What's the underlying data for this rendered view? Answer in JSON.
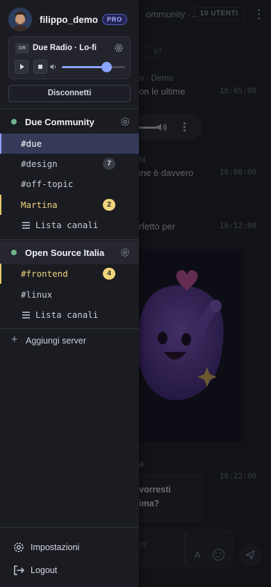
{
  "chat": {
    "title": "ommunity ·…",
    "users_badge": "10 UTENTI",
    "day_label": "ET",
    "messages": [
      {
        "author": "o · Demo",
        "text": "on le ultime",
        "time": "16:05:00"
      },
      {
        "author": "hi",
        "text": "ine è davvero",
        "time": "16:08:00"
      },
      {
        "author": "",
        "text": "rfetto per",
        "time": "16:12:00"
      },
      {
        "author": "a",
        "text": "",
        "time": "16:22:00"
      }
    ],
    "poll_line1": "vorresti",
    "poll_line2": "ima?",
    "composer_placeholder": "er",
    "format_label": "A"
  },
  "user": {
    "name": "filippo_demo",
    "badge": "PRO"
  },
  "radio": {
    "logo": "DR",
    "name": "Due Radio · Lo-fi",
    "volume": 0.7
  },
  "disconnect_label": "Disconnetti",
  "servers": [
    {
      "name": "Due Community",
      "channels": [
        {
          "label": "#due",
          "count": ""
        },
        {
          "label": "#design",
          "count": "7"
        },
        {
          "label": "#off-topic",
          "count": ""
        },
        {
          "label": "Martina",
          "count": "2"
        }
      ],
      "list_label": "Lista canali"
    },
    {
      "name": "Open Source Italia",
      "channels": [
        {
          "label": "#frontend",
          "count": "4"
        },
        {
          "label": "#linux",
          "count": ""
        }
      ],
      "list_label": "Lista canali"
    }
  ],
  "add_server_label": "Aggiungi server",
  "footer": {
    "settings_label": "Impostazioni",
    "logout_label": "Logout"
  },
  "colors": {
    "accent": "#8aa4ff",
    "unread": "#f0d37c",
    "online": "#6fb58a",
    "pro": "#a8adff"
  }
}
